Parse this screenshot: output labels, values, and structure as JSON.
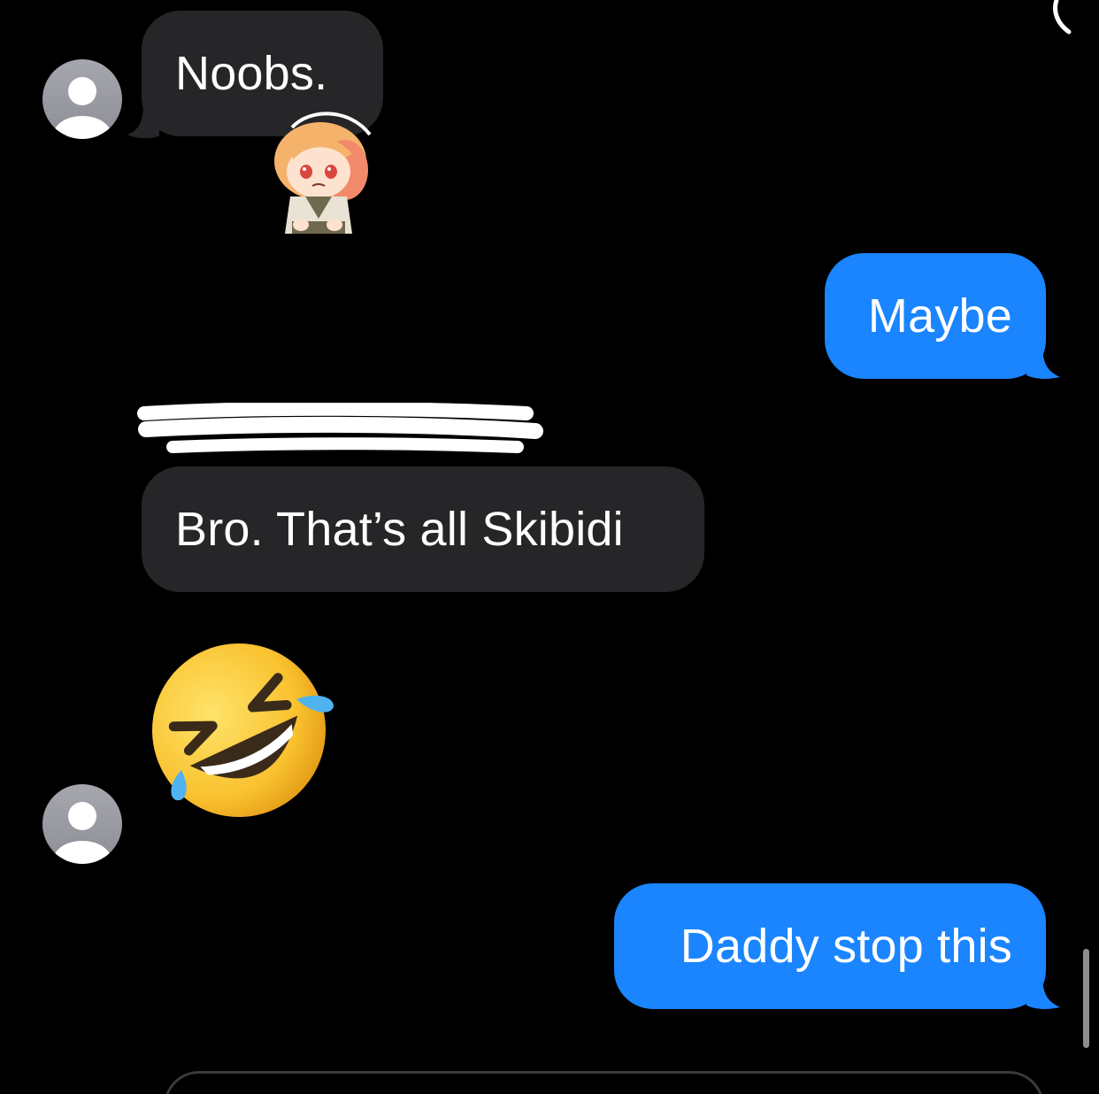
{
  "messages": [
    {
      "direction": "incoming",
      "text": "Noobs."
    },
    {
      "direction": "outgoing",
      "text": "Maybe"
    },
    {
      "direction": "incoming",
      "text": "Bro. That’s all Skibidi"
    },
    {
      "direction": "incoming",
      "emoji": "rolling-on-floor-laughing"
    },
    {
      "direction": "outgoing",
      "text": "Daddy stop this"
    }
  ],
  "colors": {
    "background": "#000000",
    "incoming_bubble": "#262629",
    "outgoing_bubble": "#1a85ff",
    "text": "#ffffff",
    "avatar": "#9a9ba2"
  },
  "icons": {
    "avatar": "person-icon",
    "sticker": "anime-chibi-sticker",
    "emoji": "rofl-emoji"
  }
}
